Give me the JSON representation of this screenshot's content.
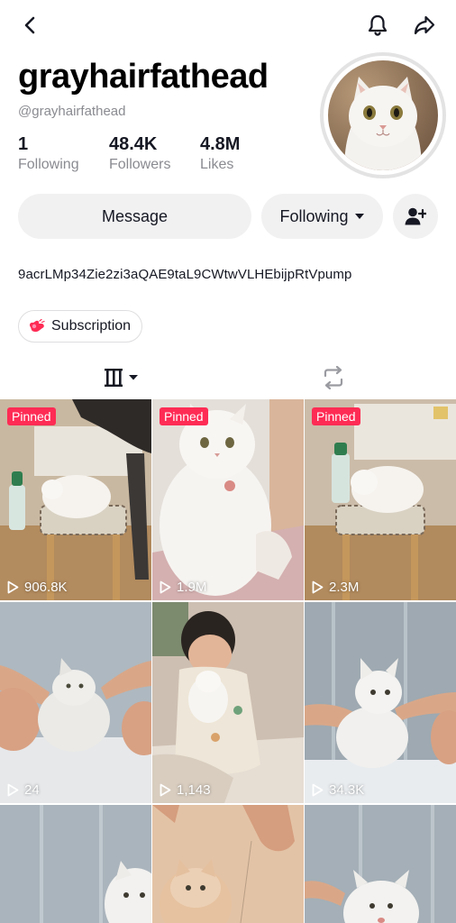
{
  "profile": {
    "username": "grayhairfathead",
    "handle": "@grayhairfathead",
    "bio": "9acrLMp34Zie2zi3aQAE9taL9CWtwVLHEbijpRtVpump"
  },
  "stats": [
    {
      "value": "1",
      "label": "Following"
    },
    {
      "value": "48.4K",
      "label": "Followers"
    },
    {
      "value": "4.8M",
      "label": "Likes"
    }
  ],
  "actions": {
    "message": "Message",
    "following": "Following",
    "subscription": "Subscription"
  },
  "videos": [
    {
      "pinned": "Pinned",
      "views": "906.8K"
    },
    {
      "pinned": "Pinned",
      "views": "1.9M"
    },
    {
      "pinned": "Pinned",
      "views": "2.3M"
    },
    {
      "views": "24"
    },
    {
      "views": "1,143"
    },
    {
      "views": "34.3K"
    },
    {},
    {},
    {}
  ],
  "colors": {
    "pinned_badge": "#fe2c55",
    "button_bg": "#f1f1f2",
    "secondary_text": "#8a8b91"
  },
  "icons": {
    "back": "back-arrow-icon",
    "bell": "bell-icon",
    "share": "share-icon",
    "add_friend": "add-friend-icon",
    "subscription": "subscription-icon",
    "videos_tab": "grid-icon",
    "reposts_tab": "repost-icon",
    "play": "play-icon"
  }
}
